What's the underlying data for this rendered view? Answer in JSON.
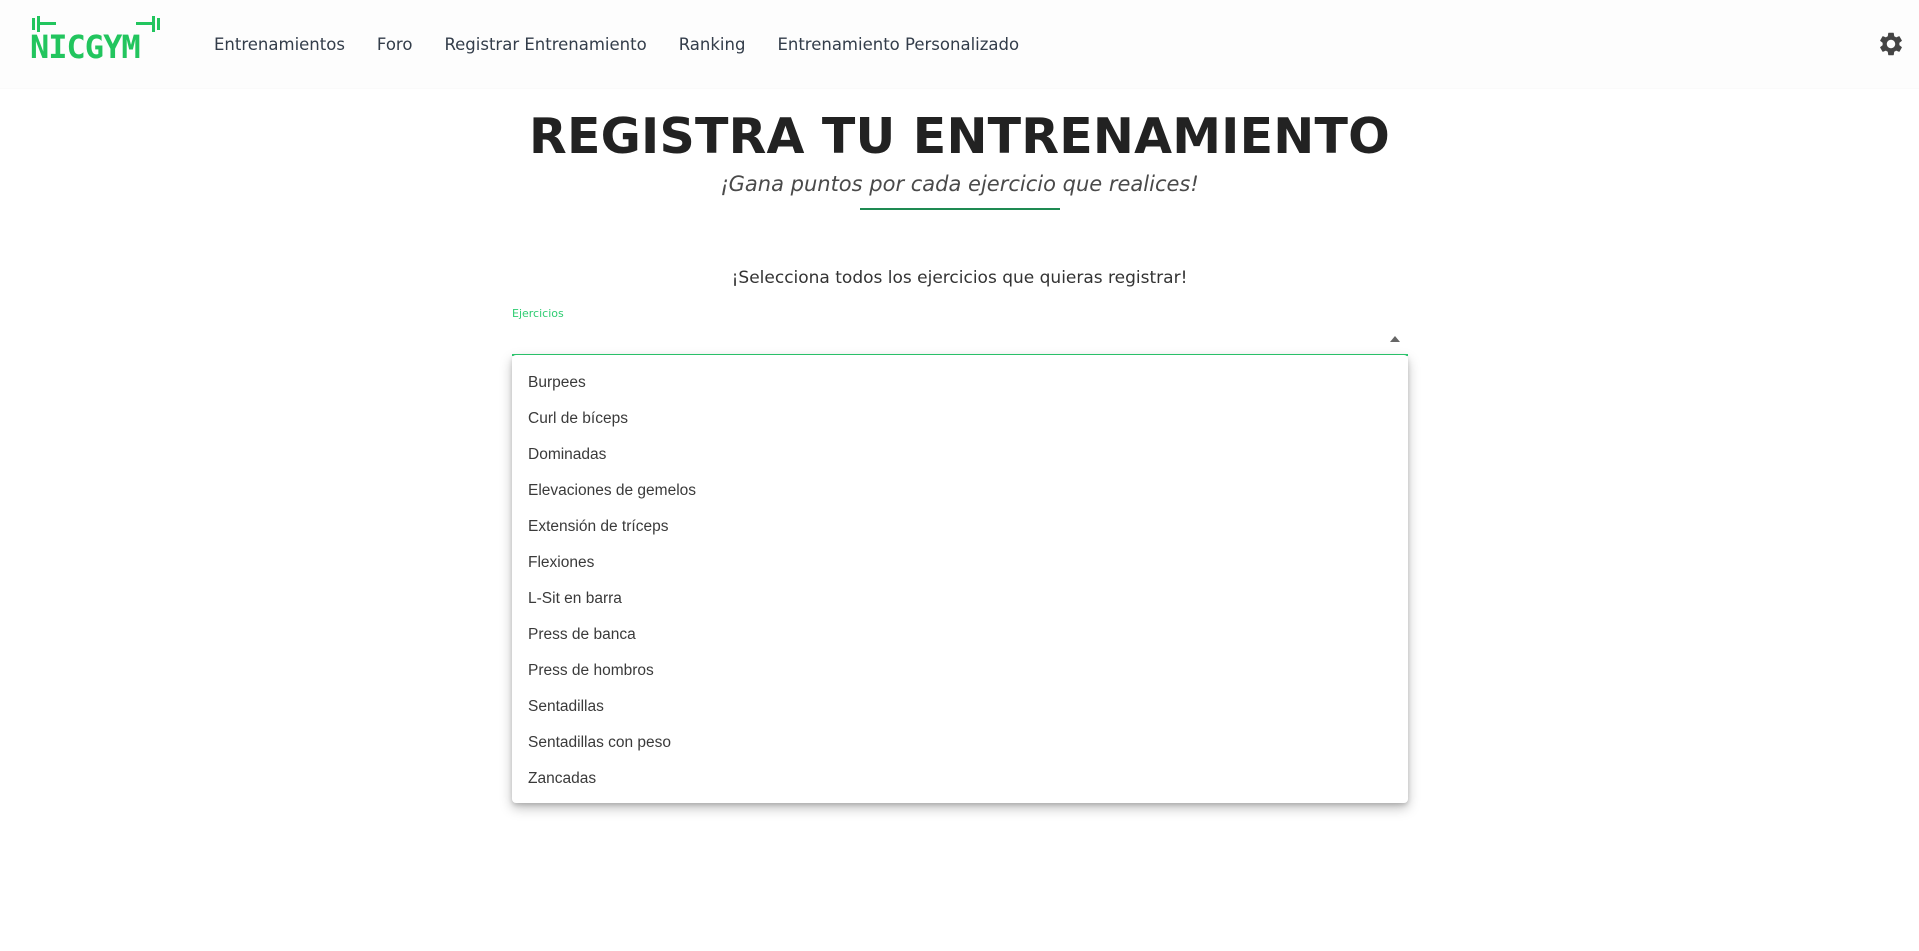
{
  "header": {
    "logo_text": "NICGYM",
    "nav": [
      "Entrenamientos",
      "Foro",
      "Registrar Entrenamiento",
      "Ranking",
      "Entrenamiento Personalizado"
    ],
    "settings_icon": "gear-icon"
  },
  "page": {
    "title": "REGISTRA TU ENTRENAMIENTO",
    "subtitle": "¡Gana puntos por cada ejercicio que realices!",
    "instruction": "¡Selecciona todos los ejercicios que quieras registrar!"
  },
  "select": {
    "label": "Ejercicios",
    "value": "",
    "options": [
      "Burpees",
      "Curl de bíceps",
      "Dominadas",
      "Elevaciones de gemelos",
      "Extensión de tríceps",
      "Flexiones",
      "L-Sit en barra",
      "Press de banca",
      "Press de hombros",
      "Sentadillas",
      "Sentadillas con peso",
      "Zancadas"
    ]
  },
  "colors": {
    "accent": "#2ecc71",
    "underline": "#1e8a52",
    "logo": "#22c55e",
    "nav_text": "#333d4a"
  }
}
